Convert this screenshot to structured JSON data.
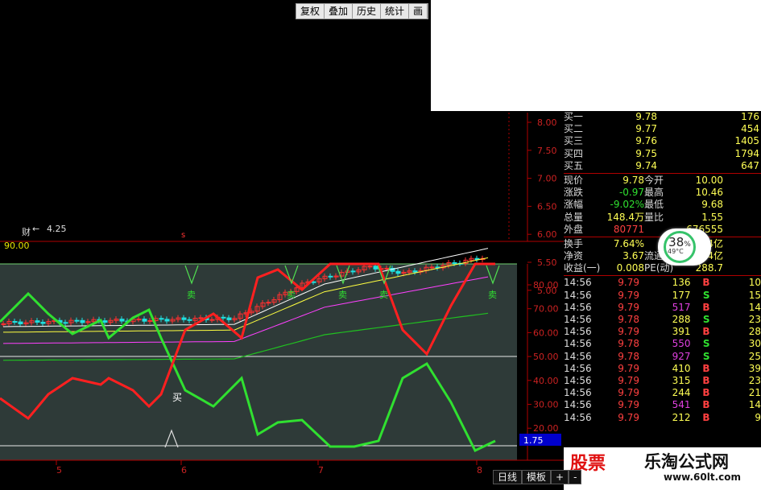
{
  "toolbar": {
    "items": [
      "复权",
      "叠加",
      "历史",
      "统计",
      "画"
    ]
  },
  "price_chart": {
    "y_ticks": [
      "8.00",
      "7.50",
      "7.00",
      "6.50",
      "6.00",
      "5.50",
      "5.00"
    ],
    "low_marker": "4.25",
    "tag_cai": "财",
    "tag_s": "s",
    "indicator_value": "90.00",
    "colors": {
      "up": "#ff3030",
      "down": "#20e0e0",
      "ma5": "#ffffff",
      "ma10": "#ffff40",
      "ma20": "#ff40ff",
      "ma60": "#20c020"
    }
  },
  "indicator": {
    "y_ticks": [
      "80.00",
      "70.00",
      "60.00",
      "50.00",
      "40.00",
      "30.00",
      "20.00"
    ],
    "current_value": "1.75",
    "buy_label": "买",
    "sell_label": "卖",
    "sell_markers": 5
  },
  "x_axis": {
    "labels": [
      "5",
      "6",
      "7",
      "8"
    ]
  },
  "quote": {
    "bids": [
      {
        "label": "买一",
        "price": "9.78",
        "vol": "176"
      },
      {
        "label": "买二",
        "price": "9.77",
        "vol": "454"
      },
      {
        "label": "买三",
        "price": "9.76",
        "vol": "1405"
      },
      {
        "label": "买四",
        "price": "9.75",
        "vol": "1794"
      },
      {
        "label": "买五",
        "price": "9.74",
        "vol": "647"
      }
    ],
    "stats": [
      {
        "l1": "现价",
        "v1": "9.78",
        "l2": "今开",
        "v2": "10.00"
      },
      {
        "l1": "涨跌",
        "v1": "-0.97",
        "l2": "最高",
        "v2": "10.46"
      },
      {
        "l1": "涨幅",
        "v1": "-9.02%",
        "l2": "最低",
        "v2": "9.68"
      },
      {
        "l1": "总量",
        "v1": "148.4万",
        "l2": "量比",
        "v2": "1.55"
      },
      {
        "l1": "外盘",
        "v1": "80771",
        "l2": "",
        "v2": "676555"
      }
    ],
    "stats2": [
      {
        "l1": "换手",
        "v1": "7.64%",
        "l2": "",
        "v2": "19.4亿"
      },
      {
        "l1": "净资",
        "v1": "3.67",
        "l2": "流通",
        "v2": "19.4亿"
      },
      {
        "l1": "收益(一)",
        "v1": "0.008",
        "l2": "PE(动)",
        "v2": "288.7"
      }
    ],
    "ticks": [
      {
        "time": "14:56",
        "price": "9.79",
        "vol": "136",
        "side": "B",
        "n": "10"
      },
      {
        "time": "14:56",
        "price": "9.79",
        "vol": "177",
        "side": "S",
        "n": "15"
      },
      {
        "time": "14:56",
        "price": "9.79",
        "vol": "517",
        "side": "B",
        "n": "14"
      },
      {
        "time": "14:56",
        "price": "9.78",
        "vol": "288",
        "side": "S",
        "n": "23"
      },
      {
        "time": "14:56",
        "price": "9.79",
        "vol": "391",
        "side": "B",
        "n": "28"
      },
      {
        "time": "14:56",
        "price": "9.78",
        "vol": "550",
        "side": "S",
        "n": "30"
      },
      {
        "time": "14:56",
        "price": "9.78",
        "vol": "927",
        "side": "S",
        "n": "25"
      },
      {
        "time": "14:56",
        "price": "9.79",
        "vol": "410",
        "side": "B",
        "n": "39"
      },
      {
        "time": "14:56",
        "price": "9.79",
        "vol": "315",
        "side": "B",
        "n": "23"
      },
      {
        "time": "14:56",
        "price": "9.79",
        "vol": "244",
        "side": "B",
        "n": "21"
      },
      {
        "time": "14:56",
        "price": "9.79",
        "vol": "541",
        "side": "B",
        "n": "14"
      },
      {
        "time": "14:56",
        "price": "9.79",
        "vol": "212",
        "side": "B",
        "n": "9"
      }
    ]
  },
  "badge": {
    "percent": "38",
    "percent_unit": "%",
    "temp": "49°C"
  },
  "watermark": {
    "logo": "股票",
    "title": "乐淘公式网",
    "url": "www.60lt.com"
  },
  "bottom": {
    "items": [
      "日线",
      "模板",
      "+",
      "-"
    ]
  }
}
